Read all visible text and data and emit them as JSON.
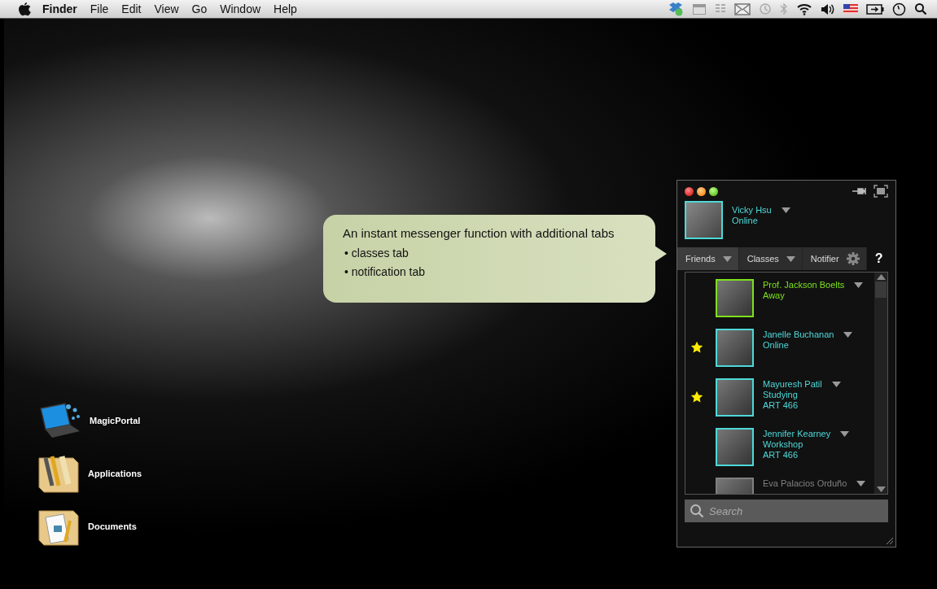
{
  "menu_bar": {
    "app_name": "Finder",
    "menus": [
      "File",
      "Edit",
      "View",
      "Go",
      "Window",
      "Help"
    ]
  },
  "desktop_icons": [
    {
      "label": "MagicPortal",
      "kind": "laptop"
    },
    {
      "label": "Applications",
      "kind": "apps"
    },
    {
      "label": "Documents",
      "kind": "docs"
    }
  ],
  "callout": {
    "title": "An instant messenger function with additional tabs",
    "bullets": [
      "• classes tab",
      "• notification tab"
    ]
  },
  "messenger": {
    "user": {
      "name": "Vicky Hsu",
      "status": "Online"
    },
    "tabs": [
      {
        "label": "Friends",
        "selected": true,
        "kind": "dropdown"
      },
      {
        "label": "Classes",
        "selected": false,
        "kind": "dropdown"
      },
      {
        "label": "Notifier",
        "selected": false,
        "kind": "settings"
      }
    ],
    "help": "?",
    "contacts": [
      {
        "name": "Prof. Jackson Boelts",
        "status": "Away",
        "starred": false,
        "color": "#7ee01e"
      },
      {
        "name": "Janelle Buchanan",
        "status": "Online",
        "starred": true,
        "color": "#4fd8d8"
      },
      {
        "name": "Mayuresh Patil",
        "status": "Studying",
        "course": "ART 466",
        "starred": true,
        "color": "#4fd8d8"
      },
      {
        "name": "Jennifer Kearney",
        "status": "Workshop",
        "course": "ART 466",
        "starred": false,
        "color": "#4fd8d8"
      },
      {
        "name": "Eva Palacios Orduño",
        "starred": false,
        "color": "#808080"
      }
    ],
    "search": {
      "placeholder": "Search"
    }
  }
}
